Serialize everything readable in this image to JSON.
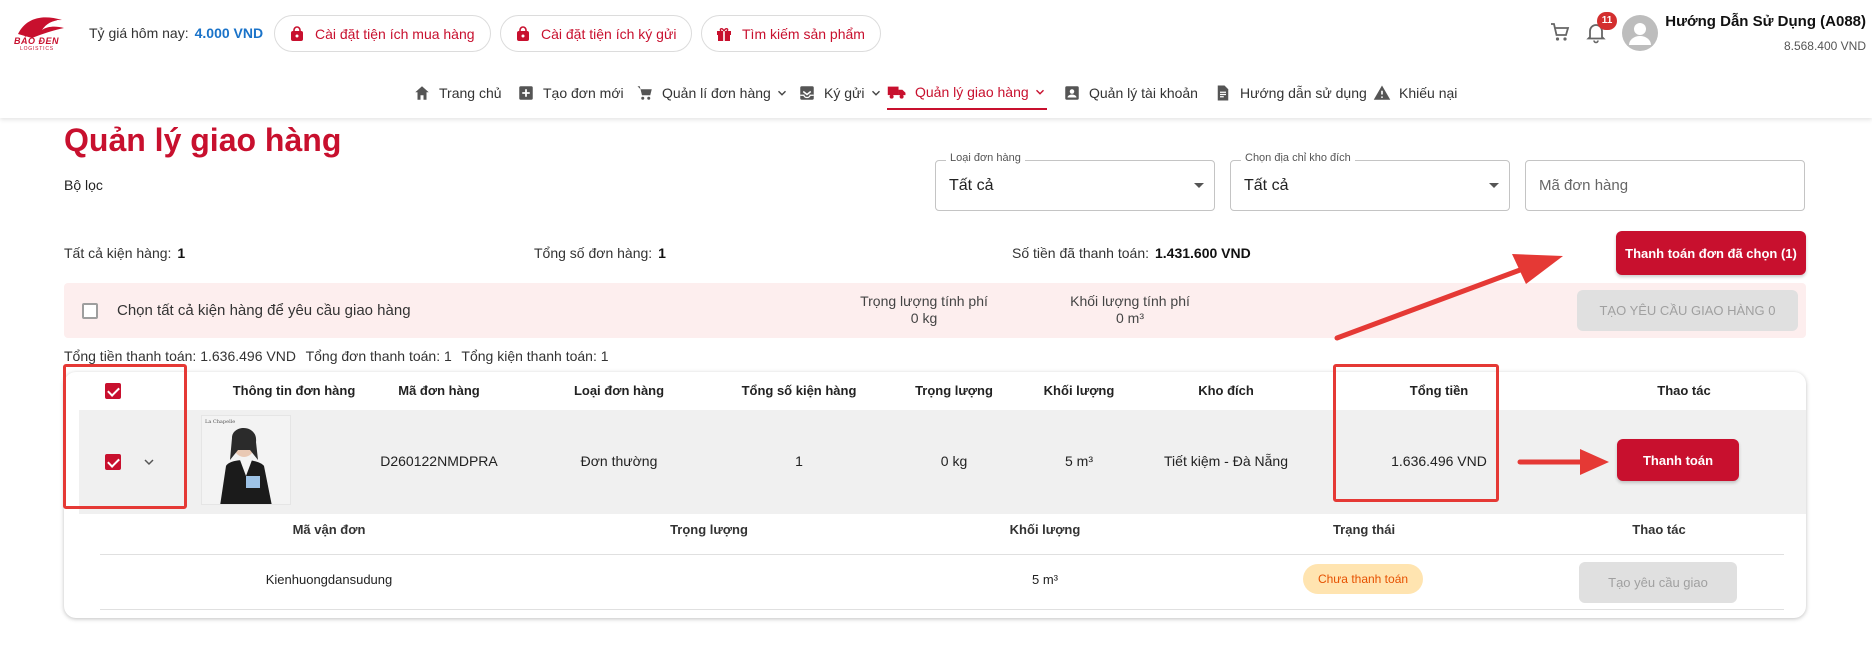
{
  "header": {
    "rate_label": "Tỷ giá hôm nay:",
    "rate_value": "4.000 VND",
    "pills": [
      {
        "label": "Cài đặt tiện ích mua hàng"
      },
      {
        "label": "Cài đặt tiện ích ký gửi"
      },
      {
        "label": "Tìm kiếm sản phẩm"
      }
    ],
    "notification_count": "11",
    "user_name": "Hướng Dẫn Sử Dụng (A088)",
    "user_balance": "8.568.400 VND",
    "brand_color": "#c8102e"
  },
  "nav": {
    "items": [
      {
        "label": "Trang chủ",
        "icon": "home-icon"
      },
      {
        "label": "Tạo đơn mới",
        "icon": "add-box-icon"
      },
      {
        "label": "Quản lí đơn hàng",
        "icon": "cart-icon"
      },
      {
        "label": "Ký gửi",
        "icon": "inbox-icon"
      },
      {
        "label": "Quản lý giao hàng",
        "icon": "truck-icon",
        "active": true
      },
      {
        "label": "Quản lý tài khoản",
        "icon": "account-box-icon"
      },
      {
        "label": "Hướng dẫn sử dụng",
        "icon": "document-icon"
      },
      {
        "label": "Khiếu nại",
        "icon": "warning-icon"
      }
    ]
  },
  "page": {
    "title": "Quản lý giao hàng",
    "filter_label": "Bộ lọc",
    "filters": {
      "order_type": {
        "label": "Loại đơn hàng",
        "value": "Tất cả"
      },
      "warehouse": {
        "label": "Chọn địa chỉ kho đích",
        "value": "Tất cả"
      },
      "order_code": {
        "placeholder": "Mã đơn hàng"
      }
    },
    "stats": {
      "all_packages_label": "Tất cả kiện hàng:",
      "all_packages_value": "1",
      "total_orders_label": "Tổng số đơn hàng:",
      "total_orders_value": "1",
      "paid_label": "Số tiền đã thanh toán:",
      "paid_value": "1.431.600 VND"
    },
    "pay_selected_button": "Thanh toán đơn đã chọn (1)",
    "select_bar": {
      "select_all_label": "Chọn tất cả kiện hàng để yêu cầu giao hàng",
      "weight_label": "Trọng lượng tính phí",
      "weight_value": "0 kg",
      "volume_label": "Khối lượng tính phí",
      "volume_value": "0 m³",
      "create_request_button": "TẠO YÊU CẦU GIAO HÀNG 0"
    },
    "totals": {
      "amount": "Tổng tiền thanh toán: 1.636.496 VND",
      "orders": "Tổng đơn thanh toán: 1",
      "packages": "Tổng kiện thanh toán: 1"
    }
  },
  "table": {
    "headers": [
      "Thông tin đơn hàng",
      "Mã đơn hàng",
      "Loại đơn hàng",
      "Tổng số kiện hàng",
      "Trọng lượng",
      "Khối lượng",
      "Kho đích",
      "Tổng tiền",
      "Thao tác"
    ],
    "rows": [
      {
        "selected": true,
        "order_code": "D260122NMDPRA",
        "order_type": "Đơn thường",
        "package_count": "1",
        "weight": "0 kg",
        "volume": "5 m³",
        "warehouse": "Tiết kiệm - Đà Nẵng",
        "total": "1.636.496 VND",
        "action": "Thanh toán",
        "thumb_caption": "La Chapelle"
      }
    ],
    "sub_headers": [
      "Mã vận đơn",
      "Trọng lượng",
      "Khối lượng",
      "Trạng thái",
      "Thao tác"
    ],
    "sub_rows": [
      {
        "tracking_code": "Kienhuongdansudung",
        "weight": "",
        "volume": "5 m³",
        "status": "Chưa thanh toán",
        "action": "Tạo yêu cầu giao"
      }
    ]
  }
}
